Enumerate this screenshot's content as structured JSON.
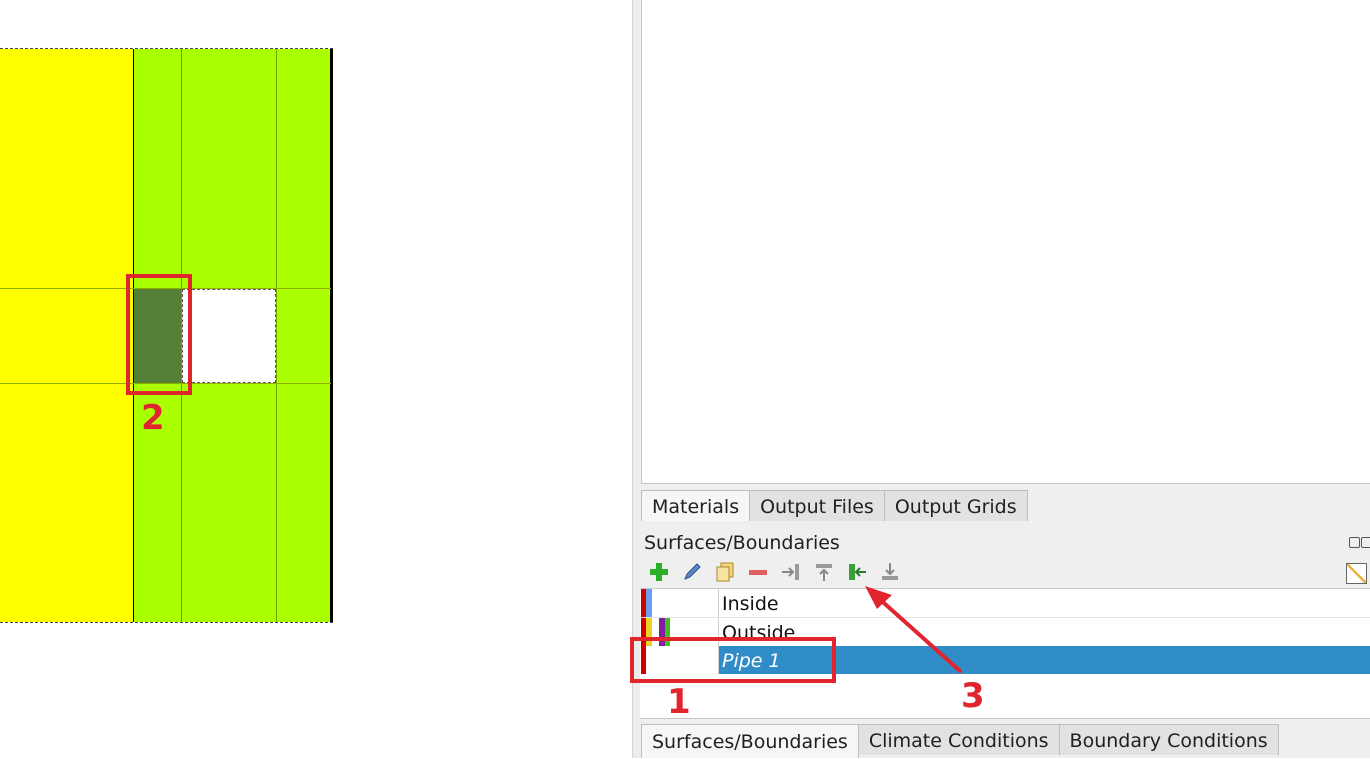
{
  "main_tabs": [
    "Materials",
    "Output Files",
    "Output Grids"
  ],
  "dock": {
    "title": "Surfaces/Boundaries",
    "toolbar_icons": [
      "add-icon",
      "edit-pencil-icon",
      "copy-icon",
      "remove-icon",
      "assign-right-icon",
      "assign-up-icon",
      "assign-selected-icon",
      "assign-bottom-icon"
    ]
  },
  "surfaces": [
    {
      "label": "Inside",
      "colors": [
        "#d00000",
        "#6e9ef0"
      ],
      "selected": false
    },
    {
      "label": "Outside",
      "colors": [
        "#d00000",
        "#f0d020",
        "#8020a0",
        "#40c020"
      ],
      "selected": false
    },
    {
      "label": "Pipe 1",
      "colors": [
        "#d00000"
      ],
      "selected": true
    }
  ],
  "bottom_tabs": [
    "Surfaces/Boundaries",
    "Climate Conditions",
    "Boundary Conditions"
  ],
  "annotations": [
    "1",
    "2",
    "3"
  ],
  "colors": {
    "material_yellow": "#ffff00",
    "material_green": "#aaff00",
    "selected_cell": "#557f35",
    "selection_blue": "#308cc6",
    "annotation_red": "#e0252f"
  }
}
